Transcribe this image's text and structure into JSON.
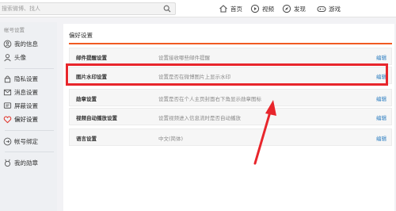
{
  "top_bar": {
    "search_placeholder": "搜索微博、找人",
    "nav": [
      {
        "label": "首页",
        "icon": "home-icon"
      },
      {
        "label": "视频",
        "icon": "video-icon"
      },
      {
        "label": "发现",
        "icon": "discover-icon"
      },
      {
        "label": "游戏",
        "icon": "game-icon"
      }
    ]
  },
  "sidebar": {
    "section_title": "帐号设置",
    "items": [
      {
        "label": "我的信息",
        "icon": "user-info-icon"
      },
      {
        "label": "头像",
        "icon": "avatar-icon"
      },
      {
        "label": "隐私设置",
        "icon": "lock-icon"
      },
      {
        "label": "消息设置",
        "icon": "message-icon"
      },
      {
        "label": "屏蔽设置",
        "icon": "block-icon"
      },
      {
        "label": "偏好设置",
        "icon": "heart-icon",
        "active": true
      },
      {
        "label": "帐号绑定",
        "icon": "bind-icon"
      },
      {
        "label": "我的勋章",
        "icon": "medal-icon"
      }
    ]
  },
  "main": {
    "title": "偏好设置",
    "accent_color": "#f05a22",
    "rows": [
      {
        "name": "邮件提醒设置",
        "desc": "设置接收哪些邮件提醒",
        "edit": "编辑"
      },
      {
        "name": "图片水印设置",
        "desc": "设置是否在微博图片上显示水印",
        "edit": "编辑",
        "highlighted": true
      },
      {
        "name": "勋章设置",
        "desc": "设置是否在个人主页封面右下角显示勋章图标",
        "edit": "编辑"
      },
      {
        "name": "视频自动播放设置",
        "desc": "设置视频进入信息流时是否自动播放",
        "edit": "编辑"
      },
      {
        "name": "语言设置",
        "desc": "中文(简体)",
        "edit": "编辑"
      }
    ]
  },
  "annotation": {
    "highlight_color": "#e8262c"
  }
}
